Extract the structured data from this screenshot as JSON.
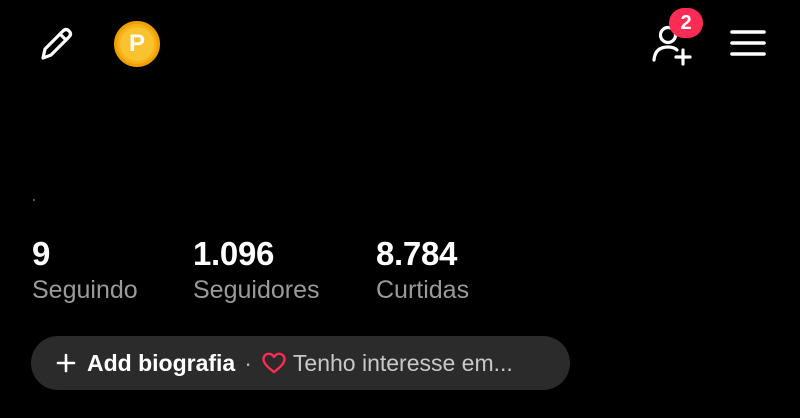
{
  "header": {
    "edit_icon": "pencil-icon",
    "coin_icon": "coin-icon",
    "coin_letter": "P",
    "add_friend_icon": "add-user-icon",
    "notification_count": "2",
    "menu_icon": "hamburger-menu-icon"
  },
  "stats": {
    "following": {
      "value": "9",
      "label": "Seguindo"
    },
    "followers": {
      "value": "1.096",
      "label": "Seguidores"
    },
    "likes": {
      "value": "8.784",
      "label": "Curtidas"
    }
  },
  "bio": {
    "add_label": "Add biografia",
    "separator": "·",
    "interest_label": "Tenho interesse em..."
  },
  "colors": {
    "background": "#000000",
    "badge": "#fe2c55",
    "coin": "#f6b21a",
    "pill": "#2b2b2b",
    "muted_text": "#9a9a9a",
    "heart": "#fe2c55"
  }
}
